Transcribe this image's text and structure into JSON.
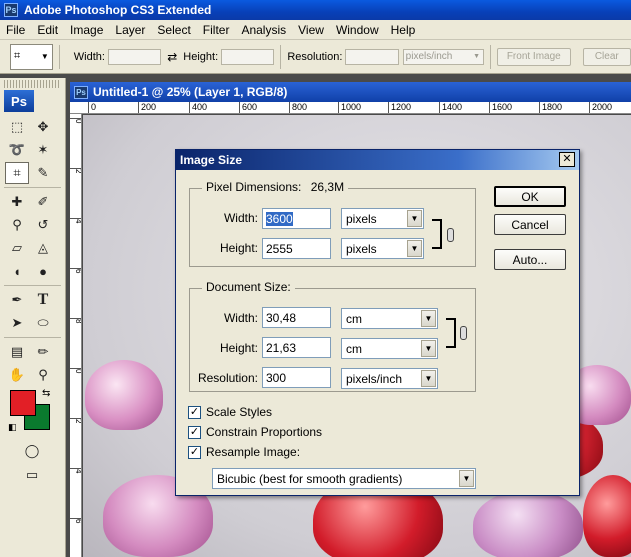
{
  "window": {
    "title": "Adobe Photoshop CS3 Extended",
    "app_icon": "Ps"
  },
  "menu": [
    "File",
    "Edit",
    "Image",
    "Layer",
    "Select",
    "Filter",
    "Analysis",
    "View",
    "Window",
    "Help"
  ],
  "options": {
    "width_label": "Width:",
    "height_label": "Height:",
    "resolution_label": "Resolution:",
    "units": "pixels/inch",
    "front_image": "Front Image",
    "clear": "Clear",
    "swap_icon": "⇄"
  },
  "toolbox": {
    "logo": "Ps",
    "foreground_color": "#e21f26",
    "background_color": "#0a7a2e"
  },
  "document": {
    "tab_title": "Untitled-1 @ 25% (Layer 1, RGB/8)",
    "ruler_h": [
      "0",
      "200",
      "400",
      "600",
      "800",
      "1000",
      "1200",
      "1400",
      "1600",
      "1800",
      "2000"
    ],
    "ruler_v": [
      "0",
      "2",
      "4",
      "6",
      "8",
      "0",
      "2",
      "4",
      "6",
      "8"
    ]
  },
  "dialog": {
    "title": "Image Size",
    "close": "✕",
    "pixel_dimensions": {
      "legend": "Pixel Dimensions:",
      "size": "26,3M",
      "width_label": "Width:",
      "width_value": "3600",
      "width_unit": "pixels",
      "height_label": "Height:",
      "height_value": "2555",
      "height_unit": "pixels"
    },
    "document_size": {
      "legend": "Document Size:",
      "width_label": "Width:",
      "width_value": "30,48",
      "width_unit": "cm",
      "height_label": "Height:",
      "height_value": "21,63",
      "height_unit": "cm",
      "resolution_label": "Resolution:",
      "resolution_value": "300",
      "resolution_unit": "pixels/inch"
    },
    "checks": {
      "scale_styles": "Scale Styles",
      "constrain": "Constrain Proportions",
      "resample": "Resample Image:",
      "check_mark": "✓"
    },
    "resample_method": "Bicubic (best for smooth gradients)",
    "buttons": {
      "ok": "OK",
      "cancel": "Cancel",
      "auto": "Auto..."
    }
  }
}
